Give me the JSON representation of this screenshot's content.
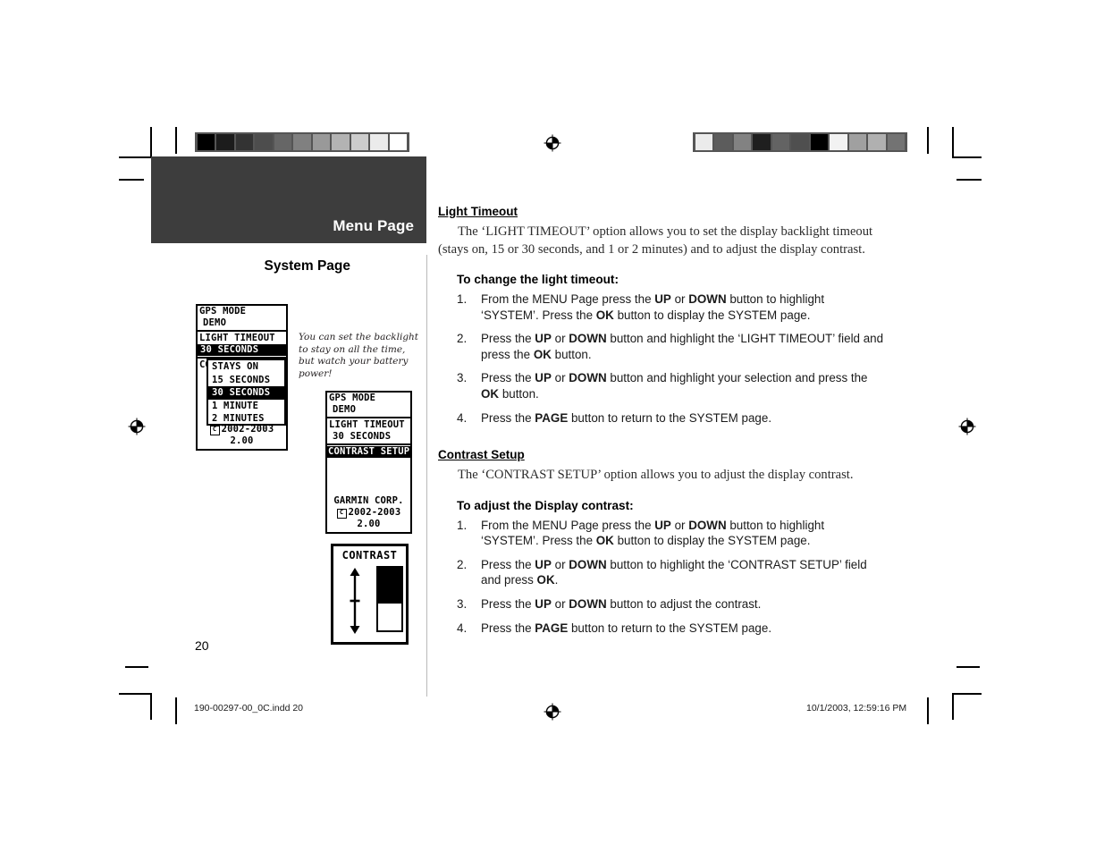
{
  "document": {
    "page_number": "20",
    "footer_left": "190-00297-00_0C.indd   20",
    "footer_right": "10/1/2003, 12:59:16 PM"
  },
  "header": {
    "band_title": "Menu Page",
    "section_title": "System Page"
  },
  "calibration": {
    "left_bar_label": "grayscale-step-wedge",
    "left_swatches": [
      "#000000",
      "#1c1c1c",
      "#333333",
      "#4d4d4d",
      "#666666",
      "#808080",
      "#999999",
      "#b3b3b3",
      "#cccccc",
      "#ebebeb",
      "#ffffff"
    ],
    "right_swatches": [
      "#ebebeb",
      "#5c5c5c",
      "#828282",
      "#1f1f1f",
      "#636363",
      "#4f4f4f",
      "#000000",
      "#f2f2f2",
      "#a0a0a0",
      "#b0b0b0",
      "#737373"
    ]
  },
  "sidenote": {
    "text": "You can set the backlight to stay on all the time, but watch your battery power!"
  },
  "screens": {
    "system_light_timeout": {
      "name": "system-page-light-timeout",
      "label_gps_mode": "GPS MODE",
      "value_gps_mode": "DEMO",
      "label_light_timeout": "LIGHT TIMEOUT",
      "value_light_timeout": "30 SECONDS",
      "hidden_field": "CONTRAST SETUP",
      "footer_line1": "GARMIN CORP.",
      "footer_copyright": "2002-2003",
      "footer_version": "2.00",
      "popup_options": [
        "STAYS ON",
        "15 SECONDS",
        "30 SECONDS",
        "1 MINUTE",
        "2 MINUTES"
      ],
      "popup_selected": "30 SECONDS"
    },
    "system_contrast": {
      "name": "system-page-contrast-setup",
      "label_gps_mode": "GPS MODE",
      "value_gps_mode": "DEMO",
      "label_light_timeout": "LIGHT TIMEOUT",
      "value_light_timeout": "30 SECONDS",
      "highlighted_field": "CONTRAST SETUP",
      "footer_line1": "GARMIN CORP.",
      "footer_copyright": "2002-2003",
      "footer_version": "2.00"
    },
    "contrast_widget": {
      "name": "contrast-adjust-dialog",
      "title": "CONTRAST",
      "fill_percent": 57
    }
  },
  "content": {
    "light_timeout": {
      "heading": "Light Timeout",
      "paragraph": "The ‘LIGHT TIMEOUT’ option allows you to set the display backlight timeout (stays on, 15 or 30 seconds, and 1 or 2 minutes) and to adjust the display contrast.",
      "subhead": "To change the light timeout:",
      "steps": [
        {
          "num": "1.",
          "parts": [
            {
              "t": "From the MENU Page press the ",
              "b": false
            },
            {
              "t": "UP",
              "b": true
            },
            {
              "t": " or ",
              "b": false
            },
            {
              "t": "DOWN",
              "b": true
            },
            {
              "t": " button to highlight ‘SYSTEM’. Press the ",
              "b": false
            },
            {
              "t": "OK",
              "b": true
            },
            {
              "t": " button to display the SYSTEM page.",
              "b": false
            }
          ]
        },
        {
          "num": "2.",
          "parts": [
            {
              "t": "Press the ",
              "b": false
            },
            {
              "t": "UP",
              "b": true
            },
            {
              "t": " or ",
              "b": false
            },
            {
              "t": "DOWN",
              "b": true
            },
            {
              "t": " button and highlight the ‘LIGHT TIMEOUT’ field and press the ",
              "b": false
            },
            {
              "t": "OK",
              "b": true
            },
            {
              "t": " button.",
              "b": false
            }
          ]
        },
        {
          "num": "3.",
          "parts": [
            {
              "t": "Press the ",
              "b": false
            },
            {
              "t": "UP",
              "b": true
            },
            {
              "t": " or ",
              "b": false
            },
            {
              "t": "DOWN",
              "b": true
            },
            {
              "t": " button and highlight your selection and press the ",
              "b": false
            },
            {
              "t": "OK",
              "b": true
            },
            {
              "t": " button.",
              "b": false
            }
          ]
        },
        {
          "num": "4.",
          "parts": [
            {
              "t": "Press the ",
              "b": false
            },
            {
              "t": "PAGE",
              "b": true
            },
            {
              "t": " button to return to the SYSTEM page.",
              "b": false
            }
          ]
        }
      ]
    },
    "contrast_setup": {
      "heading": "Contrast Setup",
      "paragraph": "The ‘CONTRAST SETUP’ option allows you to adjust the display contrast.",
      "subhead": "To adjust the Display contrast:",
      "steps": [
        {
          "num": "1.",
          "parts": [
            {
              "t": "From the MENU Page press the ",
              "b": false
            },
            {
              "t": "UP",
              "b": true
            },
            {
              "t": " or ",
              "b": false
            },
            {
              "t": "DOWN",
              "b": true
            },
            {
              "t": " button to highlight ‘SYSTEM’. Press the ",
              "b": false
            },
            {
              "t": "OK",
              "b": true
            },
            {
              "t": " button to display the SYSTEM page.",
              "b": false
            }
          ]
        },
        {
          "num": "2.",
          "parts": [
            {
              "t": "Press the ",
              "b": false
            },
            {
              "t": "UP",
              "b": true
            },
            {
              "t": " or ",
              "b": false
            },
            {
              "t": "DOWN",
              "b": true
            },
            {
              "t": " button to highlight the ‘CONTRAST SETUP’ field and press ",
              "b": false
            },
            {
              "t": "OK",
              "b": true
            },
            {
              "t": ".",
              "b": false
            }
          ]
        },
        {
          "num": "3.",
          "parts": [
            {
              "t": "Press the ",
              "b": false
            },
            {
              "t": "UP",
              "b": true
            },
            {
              "t": " or ",
              "b": false
            },
            {
              "t": "DOWN",
              "b": true
            },
            {
              "t": " button to adjust the contrast.",
              "b": false
            }
          ]
        },
        {
          "num": "4.",
          "parts": [
            {
              "t": "Press the ",
              "b": false
            },
            {
              "t": "PAGE",
              "b": true
            },
            {
              "t": " button to return to the SYSTEM page.",
              "b": false
            }
          ]
        }
      ]
    }
  }
}
